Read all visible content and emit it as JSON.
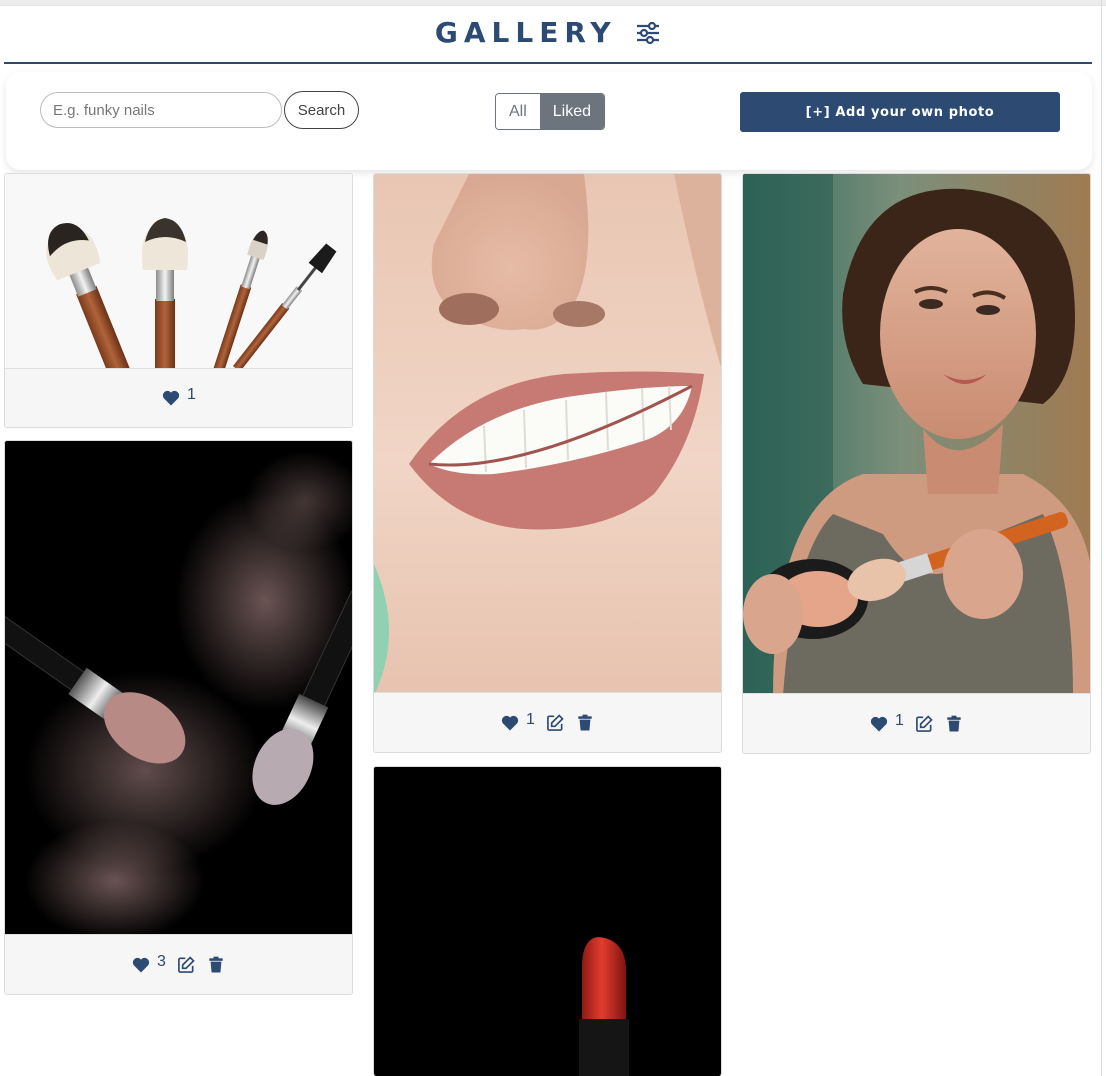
{
  "header": {
    "title": "GALLERY",
    "filter_icon": "sliders-icon"
  },
  "search": {
    "placeholder": "E.g. funky nails",
    "value": "",
    "button_label": "Search"
  },
  "filter_toggle": {
    "all_label": "All",
    "liked_label": "Liked",
    "selected": "Liked"
  },
  "add_button": {
    "label": "[+] Add your own photo"
  },
  "colors": {
    "brand": "#2c4a72",
    "toggle_active": "#6c757d"
  },
  "photos": [
    {
      "subject": "makeup brushes",
      "likes": "1",
      "editable": false
    },
    {
      "subject": "smile with pink lips",
      "likes": "1",
      "editable": true
    },
    {
      "subject": "woman applying makeup",
      "likes": "1",
      "editable": true
    },
    {
      "subject": "brushes with powder splash",
      "likes": "3",
      "editable": true
    },
    {
      "subject": "red lipstick",
      "likes": "",
      "editable": false
    }
  ],
  "icons": {
    "like": "heart-icon",
    "edit": "edit-icon",
    "delete": "trash-icon"
  }
}
